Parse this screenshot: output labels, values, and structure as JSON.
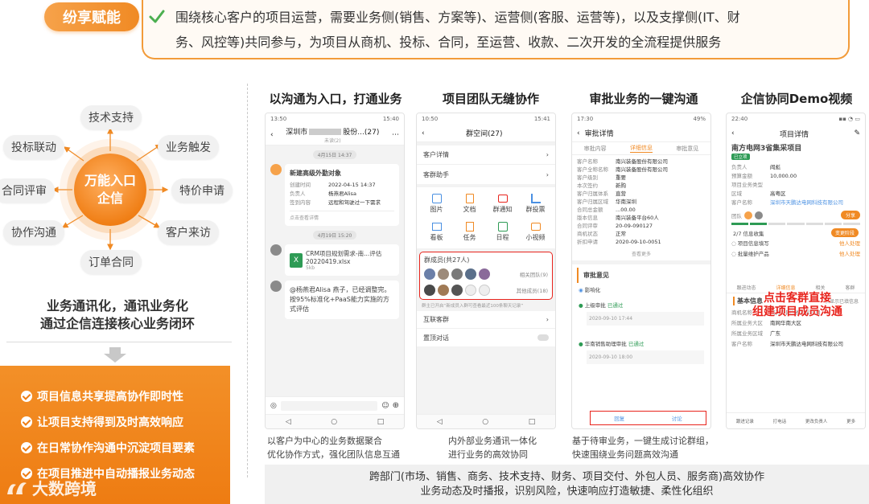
{
  "banner": {
    "tag": "纷享赋能",
    "line1": "围绕核心客户的项目运营，需要业务侧(销售、方案等)、运营侧(客服、运营等)，以及支撑侧(IT、财",
    "line2": "务、风控等)共同参与，为项目从商机、投标、合同，至运营、收款、二次开发的全流程提供服务"
  },
  "hub": {
    "line1": "万能入口",
    "line2": "企信"
  },
  "pills": [
    "技术支持",
    "业务触发",
    "特价申请",
    "客户来访",
    "订单合同",
    "协作沟通",
    "合同评审",
    "投标联动"
  ],
  "left_caption": {
    "line1": "业务通讯化，通讯业务化",
    "line2": "通过企信连接核心业务闭环"
  },
  "orange_items": [
    "项目信息共享提高协作即时性",
    "让项目支持得到及时高效响应",
    "在日常协作沟通中沉淀项目要素",
    "在项目推进中自动播报业务动态"
  ],
  "watermark": "大数跨境",
  "columns": [
    {
      "title": "以沟通为入口，打通业务",
      "caption1": "以客户为中心的业务数据聚合",
      "caption2": "优化协作方式，强化团队信息互通"
    },
    {
      "title": "项目团队无缝协作",
      "caption1": "内外部业务通讯一体化",
      "caption2": "进行业务的高效协同"
    },
    {
      "title": "审批业务的一键沟通",
      "caption1": "基于待审业务，一键生成讨论群组，",
      "caption2": "快速围绕业务问题高效沟通"
    },
    {
      "title": "企信协同Demo视频",
      "caption1": "",
      "caption2": ""
    }
  ],
  "bottom_band": {
    "line1": "跨部门(市场、销售、商务、技术支持、财务、项目交付、外包人员、服务商)高效协作",
    "line2": "业务动态及时播报，识别风险，快速响应打造敏捷、柔性化组织"
  },
  "phone1": {
    "status_time": "13:50",
    "status_right": "15:40",
    "chat_title": "深圳市",
    "chat_title_suffix": "股份...(27)",
    "chat_sub": "未读(2)",
    "date1": "4月15日 14:37",
    "card_title": "新建高级外勤对象",
    "card_rows": [
      {
        "k": "创建时间",
        "v": "2022-04-15 14:37"
      },
      {
        "k": "负责人",
        "v": "杨燕君Alisa"
      },
      {
        "k": "签到内容",
        "v": "远程和驾驶过一下需求"
      }
    ],
    "card_more": "点击查看详情",
    "date2": "4月19日 15:20",
    "file_name": "CRM项目规划需求-南...评估20220419.xlsx",
    "file_size": "5kb",
    "msg": "@杨燕君Alisa 燕子，已经调整完。按95%标准化+PaaS能力实施的方式评估"
  },
  "phone2": {
    "status_time": "10:50",
    "status_right": "15:41",
    "title": "群空间(27)",
    "rows": [
      "客户详情",
      "客群助手"
    ],
    "apps": [
      "图片",
      "文档",
      "群通知",
      "群投票",
      "看板",
      "任务",
      "日程",
      "小视频"
    ],
    "members_label": "群成员(共27人)",
    "members_right1": "相关团队(9)",
    "members_right2": "其他成员(18)",
    "note": "群主已开启“新成员入群可查看最近100条聊天记录”",
    "rows2": [
      "互联客群",
      "置顶对话"
    ]
  },
  "phone3": {
    "status_time": "17:30",
    "status_right": "49%",
    "title": "审批详情",
    "tabs": [
      "审批内容",
      "详细信息",
      "审批意见"
    ],
    "fields": [
      {
        "k": "客户名称",
        "v": "南兴装备股份有限公司"
      },
      {
        "k": "客户全称名称",
        "v": "南兴装备股份有限公司"
      },
      {
        "k": "客户级别",
        "v": "重要"
      },
      {
        "k": "本次签约",
        "v": "新购"
      },
      {
        "k": "客户归属体系",
        "v": "直营"
      },
      {
        "k": "客户归属区域",
        "v": "华南深圳"
      },
      {
        "k": "合同总金额",
        "v": "...00.00"
      },
      {
        "k": "版本信息",
        "v": "南兴装备平台60人"
      },
      {
        "k": "合同评审",
        "v": "20-09-090127"
      },
      {
        "k": "商机状态",
        "v": "正常"
      },
      {
        "k": "折扣申请",
        "v": "2020-09-10-0051"
      }
    ],
    "more": "查看更多",
    "section": "审批意见",
    "flow": [
      {
        "name": "影响化",
        "status": "",
        "time": ""
      },
      {
        "name": "上级审批",
        "status": "已通过",
        "time": "2020-09-10 17:44"
      },
      {
        "name": "华南销售助理审批",
        "status": "已通过",
        "time": "2020-09-10 18:00"
      }
    ],
    "footer_left": "回复",
    "footer_right": "讨论"
  },
  "phone4": {
    "status_time": "22:40",
    "title": "项目详情",
    "project": "南方电网3省集采项目",
    "tag": "已立项",
    "rows": [
      {
        "k": "负责人",
        "v": "阎彪"
      },
      {
        "k": "预算金额",
        "v": "10,000.00"
      },
      {
        "k": "项目业务类型",
        "v": ""
      },
      {
        "k": "区域",
        "v": "高粤区"
      },
      {
        "k": "客户名称",
        "v": "深圳市天鹏达电网科技有限公司"
      }
    ],
    "team_label": "团队",
    "share_btn": "分享",
    "stage": "2/7 信息收集",
    "stage_btn": "变更阶段",
    "tasks": [
      "项目信息填写",
      "批量维护产品"
    ],
    "task_right": "他人处理",
    "overlay1": "点击客群直接",
    "overlay2": "组建项目成员沟通",
    "subtabs": [
      "跟进动态",
      "详细信息",
      "相关",
      "客群"
    ],
    "info_title": "基本信息",
    "only_required": "仅显示已填信息",
    "info": [
      {
        "k": "商机名称",
        "v": "南方电网3省集采项目"
      },
      {
        "k": "所属业务大区",
        "v": "南网华南大区"
      },
      {
        "k": "所属业务区域",
        "v": "广东"
      },
      {
        "k": "客户名称",
        "v": "深圳市天鹏达电网科技有限公司"
      }
    ],
    "bottom_actions": [
      "跟进记录",
      "打电话",
      "更改负责人",
      "更多"
    ]
  },
  "colors": {
    "accent": "#f08a24",
    "highlight": "#e8231c"
  }
}
